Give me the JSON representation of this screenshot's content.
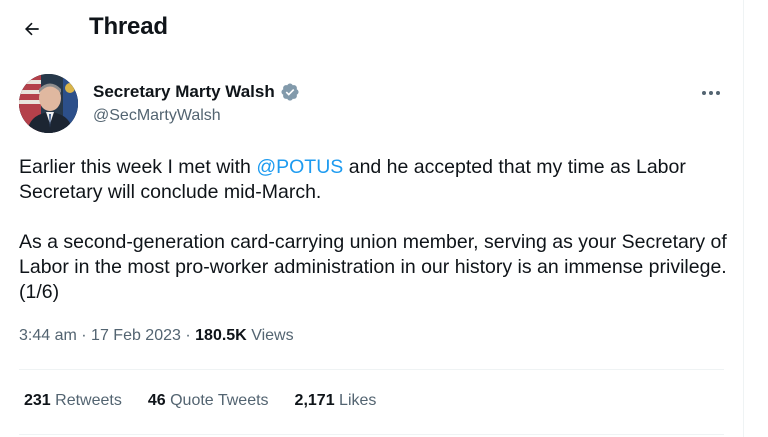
{
  "header": {
    "title": "Thread"
  },
  "tweet": {
    "author": {
      "display_name": "Secretary Marty Walsh",
      "handle": "@SecMartyWalsh",
      "verified_badge_color": "#829aab"
    },
    "text": {
      "p1_before": "Earlier this week I met with ",
      "mention": "@POTUS",
      "p1_after": " and he accepted that my time as Labor Secretary will conclude mid-March.",
      "p2": "As a second-generation card-carrying union member, serving as your Secretary of Labor in the most pro-worker administration in our history is an immense privilege. (1/6)"
    },
    "time": "3:44 am",
    "separator": "·",
    "date": "17 Feb 2023",
    "views_count": "180.5K",
    "views_label": "Views",
    "stats": {
      "retweets_count": "231",
      "retweets_label": "Retweets",
      "quotes_count": "46",
      "quotes_label": "Quote Tweets",
      "likes_count": "2,171",
      "likes_label": "Likes"
    }
  },
  "colors": {
    "accent": "#1d9bf0",
    "secondary_text": "#536471",
    "primary_text": "#0f1419"
  }
}
